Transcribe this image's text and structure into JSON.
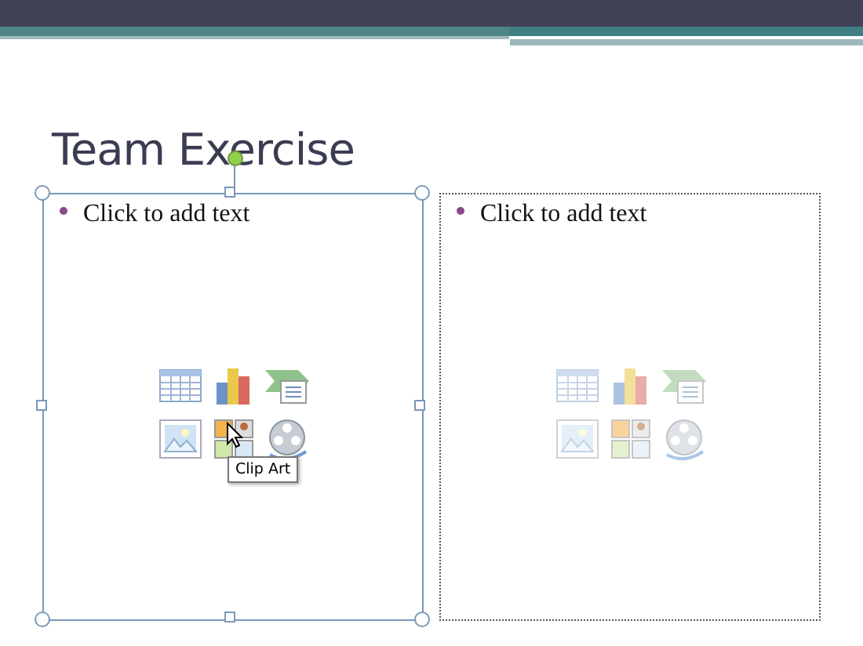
{
  "slide": {
    "title": "Team Exercise"
  },
  "placeholders": [
    {
      "bullet": "Click to add text",
      "selected": true,
      "tooltip": "Clip Art"
    },
    {
      "bullet": "Click to add text",
      "selected": false
    }
  ]
}
